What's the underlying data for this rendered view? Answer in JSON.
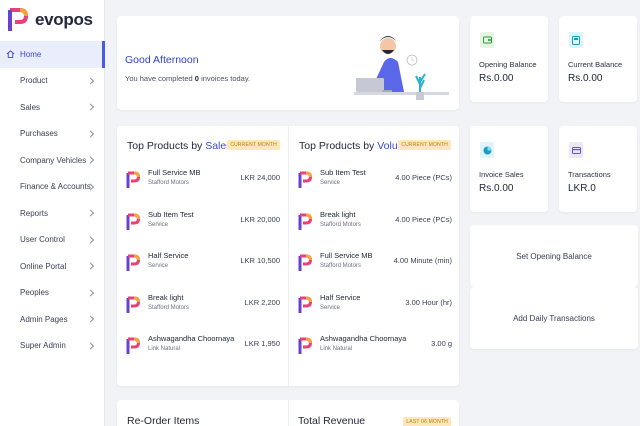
{
  "brand": {
    "name": "evopos"
  },
  "sidebar": {
    "items": [
      {
        "label": "Home",
        "active": true
      },
      {
        "label": "Product"
      },
      {
        "label": "Sales"
      },
      {
        "label": "Purchases"
      },
      {
        "label": "Company Vehicles"
      },
      {
        "label": "Finance & Accounts"
      },
      {
        "label": "Reports"
      },
      {
        "label": "User Control"
      },
      {
        "label": "Online Portal"
      },
      {
        "label": "Peoples"
      },
      {
        "label": "Admin Pages"
      },
      {
        "label": "Super Admin"
      }
    ]
  },
  "greeting": {
    "title": "Good Afternoon",
    "prefix": "You have completed",
    "count": "0",
    "suffix": "invoices today."
  },
  "stats": [
    {
      "label": "Opening Balance",
      "value": "Rs.0.00",
      "icon": "wallet-icon",
      "color": "#e3f6e0",
      "icon_color": "#2e9a41"
    },
    {
      "label": "Current Balance",
      "value": "Rs.0.00",
      "icon": "card-icon",
      "color": "#dff4fb",
      "icon_color": "#1b9cc4"
    },
    {
      "label": "Invoice Sales",
      "value": "Rs.0.00",
      "icon": "pie-icon",
      "color": "#dff4fb",
      "icon_color": "#1b9cc4"
    },
    {
      "label": "Transactions",
      "value": "LKR.0",
      "icon": "creditcard-icon",
      "color": "#ece8fb",
      "icon_color": "#6b4fd8"
    }
  ],
  "actions": {
    "set_opening": "Set Opening Balance",
    "add_daily": "Add Daily Transactions"
  },
  "top_sales": {
    "title_prefix": "Top Products by",
    "title_highlight": "Sales",
    "badge": "CURRENT MONTH",
    "rows": [
      {
        "name": "Full Service MB",
        "sub": "Stafford Motors",
        "value": "LKR 24,000"
      },
      {
        "name": "Sub Item Test",
        "sub": "Service",
        "value": "LKR 20,000"
      },
      {
        "name": "Half Service",
        "sub": "Service",
        "value": "LKR 10,500"
      },
      {
        "name": "Break light",
        "sub": "Stafford Motors",
        "value": "LKR 2,200"
      },
      {
        "name": "Ashwagandha Choornaya",
        "sub": "Link Natural",
        "value": "LKR 1,950"
      }
    ]
  },
  "top_volume": {
    "title_prefix": "Top Products by",
    "title_highlight": "Volume",
    "badge": "CURRENT MONTH",
    "rows": [
      {
        "name": "Sub Item Test",
        "sub": "Service",
        "value": "4.00 Piece (PCs)"
      },
      {
        "name": "Break light",
        "sub": "Stafford Motors",
        "value": "4.00 Piece (PCs)"
      },
      {
        "name": "Full Service MB",
        "sub": "Stafford Motors",
        "value": "4.00 Minute (min)"
      },
      {
        "name": "Half Service",
        "sub": "Service",
        "value": "3.00 Hour (hr)"
      },
      {
        "name": "Ashwagandha Choornaya",
        "sub": "Link Natural",
        "value": "3.00 g"
      }
    ]
  },
  "bottom": {
    "reorder_title": "Re-Order Items",
    "revenue_title": "Total Revenue",
    "revenue_badge": "LAST 06 MONTH"
  }
}
